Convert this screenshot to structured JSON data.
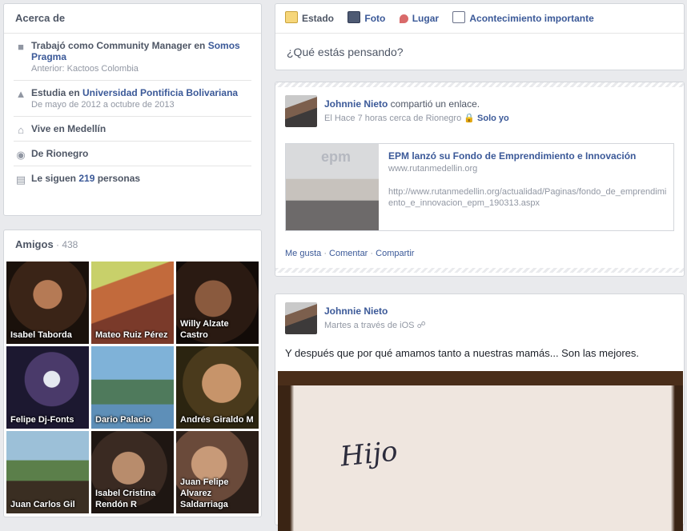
{
  "about": {
    "title": "Acerca de",
    "work": {
      "prefix": "Trabajó como Community Manager en ",
      "company": "Somos Pragma",
      "previous": "Anterior: Kactoos Colombia"
    },
    "study": {
      "prefix": "Estudia en ",
      "school": "Universidad Pontificia Bolivariana",
      "dates": "De mayo de 2012 a octubre de 2013"
    },
    "lives": "Vive en Medellín",
    "from": "De Rionegro",
    "followers": {
      "prefix": "Le siguen ",
      "count": "219",
      "suffix": " personas"
    }
  },
  "friends": {
    "title": "Amigos",
    "count": " · 438",
    "items": [
      {
        "name": "Isabel Taborda"
      },
      {
        "name": "Mateo Ruiz Pérez"
      },
      {
        "name": "Willy Alzate Castro"
      },
      {
        "name": "Felipe Dj-Fonts"
      },
      {
        "name": "Dario Palacio"
      },
      {
        "name": "Andrés Giraldo M"
      },
      {
        "name": "Juan Carlos Gil"
      },
      {
        "name": "Isabel Cristina Rendón R"
      },
      {
        "name": "Juan Felipe Alvarez Saldarriaga"
      }
    ]
  },
  "composer": {
    "tabs": [
      "Estado",
      "Foto",
      "Lugar",
      "Acontecimiento importante"
    ],
    "placeholder": "¿Qué estás pensando?"
  },
  "story1": {
    "author": "Johnnie Nieto",
    "action": " compartió un enlace.",
    "meta": "El Hace 7 horas cerca de Rionegro",
    "privacy": "Solo yo",
    "link": {
      "title": "EPM lanzó su Fondo de Emprendimiento e Innovación",
      "domain": "www.rutanmedellin.org",
      "url": "http://www.rutanmedellin.org/actualidad/Paginas/fondo_de_emprendimiento_e_innovacion_epm_190313.aspx"
    },
    "actions": {
      "like": "Me gusta",
      "comment": "Comentar",
      "share": "Compartir"
    }
  },
  "story2": {
    "author": "Johnnie Nieto",
    "meta": "Martes a través de iOS",
    "text": "Y después que por qué amamos tanto a nuestras mamás... Son las mejores.",
    "photo_text": "Hijo"
  }
}
